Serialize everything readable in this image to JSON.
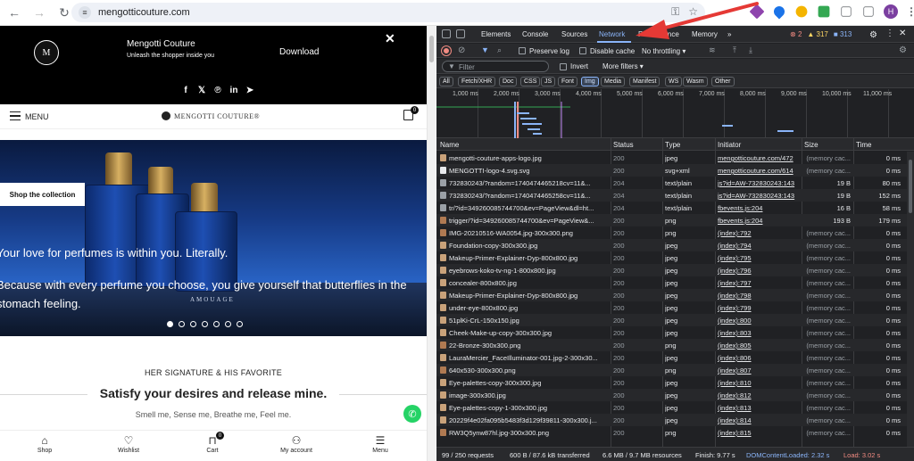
{
  "browser": {
    "url": "mengotticouture.com",
    "avatar_letter": "H",
    "colors": {
      "ext1": "#8e44ad",
      "ext2": "#1a73e8",
      "ext3": "#f4b400",
      "ext4": "#ea4335",
      "ext5": "#34a853"
    }
  },
  "site": {
    "promo": {
      "title": "Mengotti Couture",
      "tagline": "Unleash the shopper inside you",
      "download": "Download",
      "close": "✕"
    },
    "social": [
      "f",
      "𝕏",
      "℗",
      "in",
      "➤"
    ],
    "menu_label": "MENU",
    "brand": "MENGOTTI COUTURE®",
    "cart_count": "0",
    "hero": {
      "shop_button": "Shop the collection",
      "line1": "Your love for perfumes is within you. Literally.",
      "line2": "Because with every perfume you choose, you give yourself that butterflies in the",
      "line3": "stomach feeling.",
      "bottle_label": "AMOUAGE"
    },
    "signature": "HER SIGNATURE & HIS FAVORITE",
    "headline": "Satisfy your desires and release mine.",
    "subline": "Smell me, Sense me, Breathe me, Feel me.",
    "bottom_nav": [
      {
        "label": "Shop",
        "icon": "⌂"
      },
      {
        "label": "Wishlist",
        "icon": "♡"
      },
      {
        "label": "Cart",
        "icon": "⊓"
      },
      {
        "label": "My account",
        "icon": "⚇"
      },
      {
        "label": "Menu",
        "icon": "☰"
      }
    ]
  },
  "devtools": {
    "tabs": [
      "Elements",
      "Console",
      "Sources",
      "Network",
      "Performance",
      "Memory",
      "»"
    ],
    "counts": {
      "errors": "2",
      "warnings": "317",
      "info": "313"
    },
    "toolbar": {
      "preserve_log": "Preserve log",
      "disable_cache": "Disable cache",
      "throttling": "No throttling"
    },
    "filter": {
      "placeholder": "Filter",
      "invert": "Invert",
      "more_filters": "More filters"
    },
    "type_filters": [
      "All",
      "Fetch/XHR",
      "Doc",
      "CSS",
      "JS",
      "Font",
      "Img",
      "Media",
      "Manifest",
      "WS",
      "Wasm",
      "Other"
    ],
    "active_filter": "Img",
    "timeline_ticks": [
      "1,000 ms",
      "2,000 ms",
      "3,000 ms",
      "4,000 ms",
      "5,000 ms",
      "6,000 ms",
      "7,000 ms",
      "8,000 ms",
      "9,000 ms",
      "10,000 ms",
      "11,000 ms"
    ],
    "columns": [
      "Name",
      "Status",
      "Type",
      "Initiator",
      "Size",
      "Time"
    ],
    "rows": [
      {
        "name": "mengotti-couture-apps-logo.jpg",
        "status": "200",
        "type": "jpeg",
        "initiator": "mengotticouture.com/472",
        "size": "(memory cac...",
        "time": "0 ms"
      },
      {
        "name": "MENGOTTI-logo-4.svg.svg",
        "status": "200",
        "type": "svg+xml",
        "initiator": "mengotticouture.com/614",
        "size": "(memory cac...",
        "time": "0 ms"
      },
      {
        "name": "732830243/?random=1740474465218cv=11&...",
        "status": "204",
        "type": "text/plain",
        "initiator": "js?id=AW-732830243:143",
        "size": "19 B",
        "time": "80 ms"
      },
      {
        "name": "732830243/?random=1740474465258cv=11&...",
        "status": "204",
        "type": "text/plain",
        "initiator": "js?id=AW-732830243:143",
        "size": "19 B",
        "time": "152 ms"
      },
      {
        "name": "tr/?id=349260085744700&ev=PageView&dl=ht...",
        "status": "204",
        "type": "text/plain",
        "initiator": "fbevents.js:204",
        "size": "16 B",
        "time": "58 ms"
      },
      {
        "name": "trigger/?id=349260085744700&ev=PageView&...",
        "status": "200",
        "type": "png",
        "initiator": "fbevents.js:204",
        "size": "193 B",
        "time": "179 ms"
      },
      {
        "name": "IMG-20210516-WA0054.jpg-300x300.png",
        "status": "200",
        "type": "png",
        "initiator": "(index):792",
        "size": "(memory cac...",
        "time": "0 ms"
      },
      {
        "name": "Foundation-copy-300x300.jpg",
        "status": "200",
        "type": "jpeg",
        "initiator": "(index):794",
        "size": "(memory cac...",
        "time": "0 ms"
      },
      {
        "name": "Makeup-Primer-Explainer-Dyp-800x800.jpg",
        "status": "200",
        "type": "jpeg",
        "initiator": "(index):795",
        "size": "(memory cac...",
        "time": "0 ms"
      },
      {
        "name": "eyebrows-koko-tv-ng-1-800x800.jpg",
        "status": "200",
        "type": "jpeg",
        "initiator": "(index):796",
        "size": "(memory cac...",
        "time": "0 ms"
      },
      {
        "name": "concealer-800x800.jpg",
        "status": "200",
        "type": "jpeg",
        "initiator": "(index):797",
        "size": "(memory cac...",
        "time": "0 ms"
      },
      {
        "name": "Makeup-Primer-Explainer-Dyp-800x800.jpg",
        "status": "200",
        "type": "jpeg",
        "initiator": "(index):798",
        "size": "(memory cac...",
        "time": "0 ms"
      },
      {
        "name": "under-eye-800x800.jpg",
        "status": "200",
        "type": "jpeg",
        "initiator": "(index):799",
        "size": "(memory cac...",
        "time": "0 ms"
      },
      {
        "name": "51plKi-CrL-150x150.jpg",
        "status": "200",
        "type": "jpeg",
        "initiator": "(index):800",
        "size": "(memory cac...",
        "time": "0 ms"
      },
      {
        "name": "Cheek-Make-up-copy-300x300.jpg",
        "status": "200",
        "type": "jpeg",
        "initiator": "(index):803",
        "size": "(memory cac...",
        "time": "0 ms"
      },
      {
        "name": "22-Bronze-300x300.png",
        "status": "200",
        "type": "png",
        "initiator": "(index):805",
        "size": "(memory cac...",
        "time": "0 ms"
      },
      {
        "name": "LauraMercier_FaceIlluminator-001.jpg-2-300x30...",
        "status": "200",
        "type": "jpeg",
        "initiator": "(index):806",
        "size": "(memory cac...",
        "time": "0 ms"
      },
      {
        "name": "640x530-300x300.png",
        "status": "200",
        "type": "png",
        "initiator": "(index):807",
        "size": "(memory cac...",
        "time": "0 ms"
      },
      {
        "name": "Eye-palettes-copy-300x300.jpg",
        "status": "200",
        "type": "jpeg",
        "initiator": "(index):810",
        "size": "(memory cac...",
        "time": "0 ms"
      },
      {
        "name": "image-300x300.jpg",
        "status": "200",
        "type": "jpeg",
        "initiator": "(index):812",
        "size": "(memory cac...",
        "time": "0 ms"
      },
      {
        "name": "Eye-palettes-copy-1-300x300.jpg",
        "status": "200",
        "type": "jpeg",
        "initiator": "(index):813",
        "size": "(memory cac...",
        "time": "0 ms"
      },
      {
        "name": "20229f4e02fa095b5483f3d129f39811-300x300.j...",
        "status": "200",
        "type": "jpeg",
        "initiator": "(index):814",
        "size": "(memory cac...",
        "time": "0 ms"
      },
      {
        "name": "RW3Q5ynw87hl.jpg-300x300.png",
        "status": "200",
        "type": "png",
        "initiator": "(index):815",
        "size": "(memory cac...",
        "time": "0 ms"
      }
    ],
    "status_bar": {
      "requests": "99 / 250 requests",
      "transferred": "600 B / 87.6 kB transferred",
      "resources": "6.6 MB / 9.7 MB resources",
      "finish": "Finish: 9.77 s",
      "dcl": "DOMContentLoaded: 2.32 s",
      "load": "Load: 3.02 s"
    }
  }
}
